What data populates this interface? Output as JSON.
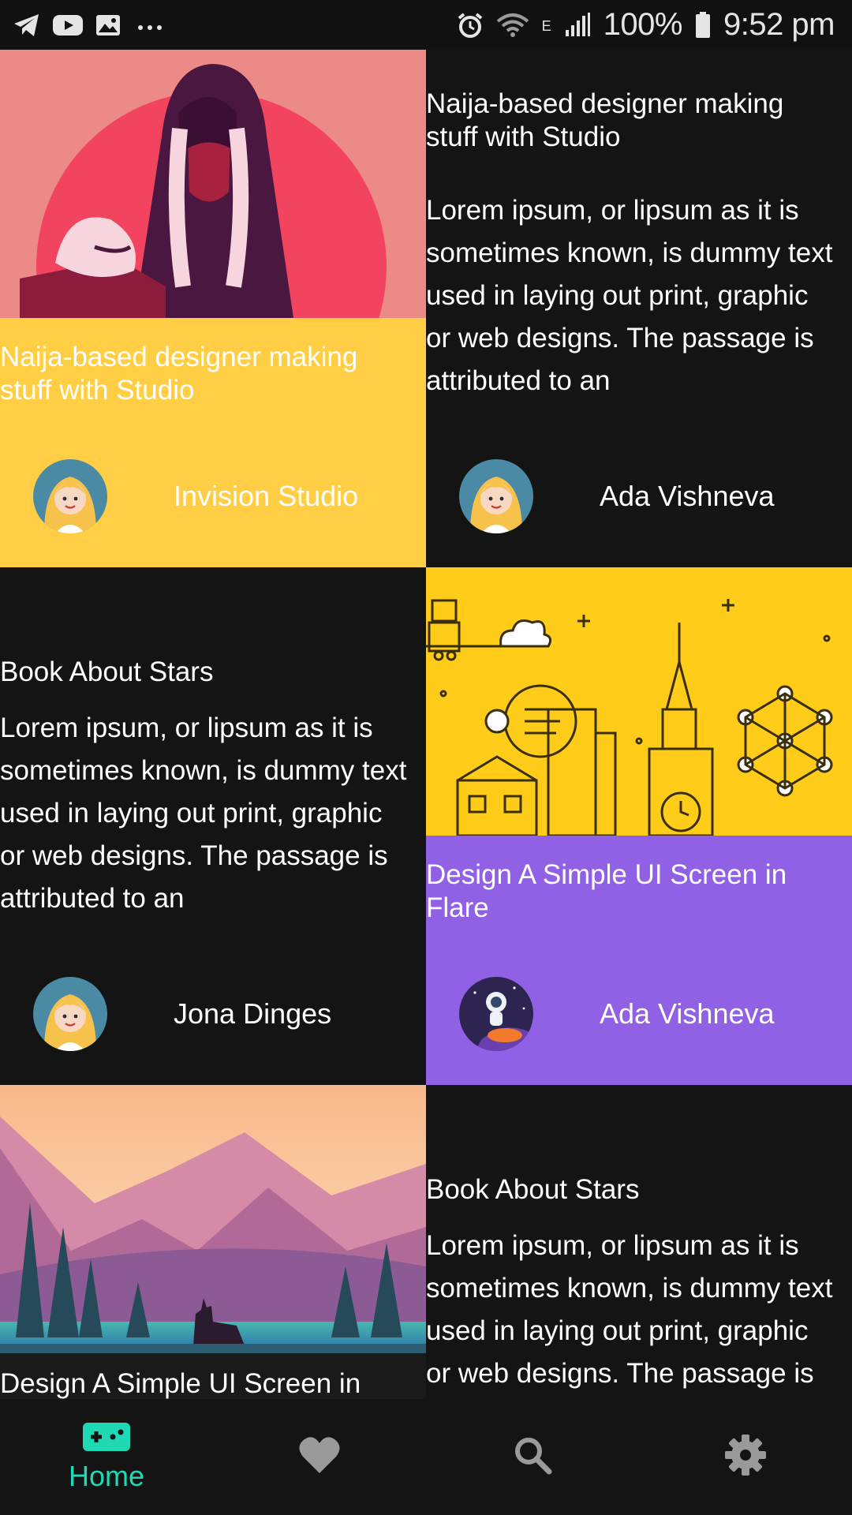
{
  "status_bar": {
    "left_icons": [
      "telegram-icon",
      "youtube-icon",
      "gallery-icon",
      "more-dots-icon"
    ],
    "right_icons": [
      "alarm-icon",
      "wifi-icon",
      "network-e-icon",
      "signal-icon"
    ],
    "battery": "100%",
    "time": "9:52 pm"
  },
  "colors": {
    "background": "#141414",
    "yellow_card": "#FFCE44",
    "purple_card": "#9061E4",
    "accent": "#1ED9B4",
    "nav_inactive": "#9A9A9A"
  },
  "cards": [
    {
      "title": "Naija-based designer making stuff with Studio",
      "author": "Invision Studio",
      "image": "woman-illustration",
      "avatar": "girl-avatar-icon"
    },
    {
      "title": "Naija-based designer making stuff with Studio",
      "description": "Lorem ipsum, or lipsum as it is sometimes known, is dummy text used in laying out print, graphic or web designs. The passage is attributed to an",
      "author": "Ada Vishneva",
      "avatar": "girl-avatar-icon"
    },
    {
      "title": "Book About Stars",
      "description": "Lorem ipsum, or lipsum as it is sometimes known, is dummy text used in laying out print, graphic or web designs. The passage is attributed to an",
      "author": "Jona Dinges",
      "avatar": "girl-avatar-icon"
    },
    {
      "title": "Design A Simple UI Screen in Flare",
      "author": "Ada Vishneva",
      "image": "city-illustration",
      "avatar": "astronaut-avatar-icon"
    },
    {
      "title": "Design A Simple UI Screen in",
      "image": "mountain-landscape"
    },
    {
      "title": "Book About Stars",
      "description": "Lorem ipsum, or lipsum as it is sometimes known, is dummy text used in laying out print, graphic or web designs. The passage is attributed to an"
    }
  ],
  "nav": {
    "home_label": "Home",
    "items": [
      "gamepad-icon",
      "heart-icon",
      "search-icon",
      "gear-icon"
    ]
  }
}
